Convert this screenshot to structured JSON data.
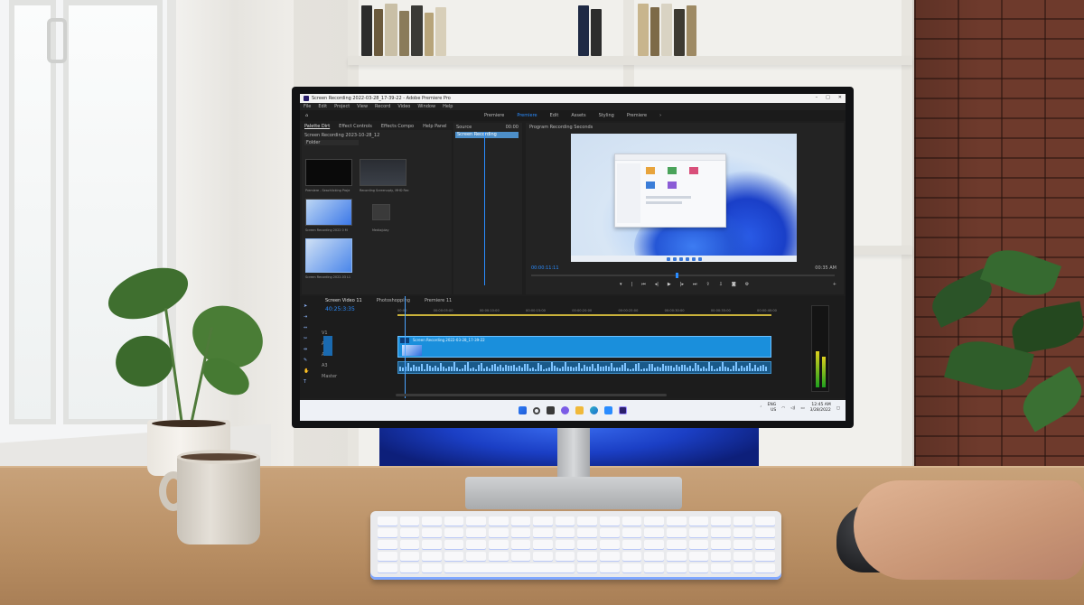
{
  "app": {
    "title": "Screen Recording 2022-03-28_17-39-22 - Adobe Premiere Pro",
    "menus": [
      "File",
      "Edit",
      "Project",
      "View",
      "Record",
      "Video",
      "Window",
      "Help"
    ],
    "workspaces": [
      "Premiere",
      "Premiere",
      "Edit",
      "Assets",
      "Styling",
      "Premiere"
    ],
    "active_workspace_index": 1
  },
  "project_panel": {
    "tabs": [
      "Palette Dirt",
      "Effect Controls",
      "Effects Compo",
      "Help Panel"
    ],
    "bin_name": "Screen Recording 2023-10-28_12",
    "dropdown": "Folder",
    "items": [
      "Premiere - Seachlicking Proje",
      "Recording Screenvpty, MHD Rec",
      "Screen Recording 2022 0 M",
      "Media/play",
      "Screen Recording 2022-03 L1"
    ]
  },
  "source_panel": {
    "header": "Source",
    "time": "00:00",
    "clip": "Screen Recording"
  },
  "program_panel": {
    "title": "Program Recording Seconds",
    "timecode_in": "00:00:11:11",
    "timecode_out": "00:35 AM"
  },
  "timeline": {
    "tabs": [
      "Screen Video 11",
      "Photoshopping",
      "Premiere 11"
    ],
    "timecode": "40:25:3:35",
    "ruler": [
      "00:00",
      "00:00:05:00",
      "00:00:10:00",
      "00:00:15:00",
      "00:00:20:00",
      "00:00:25:00",
      "00:00:30:00",
      "00:00:35:00",
      "00:00:40:00"
    ],
    "video_clip_label": "Screen Recording 2022-03-28_17-39-22",
    "tracks": [
      "V1",
      "A1",
      "A2",
      "A3",
      "Master"
    ]
  },
  "taskbar": {
    "lang": "ENG",
    "lang_sub": "US",
    "time": "12:45 AM",
    "date": "3/28/2022"
  }
}
